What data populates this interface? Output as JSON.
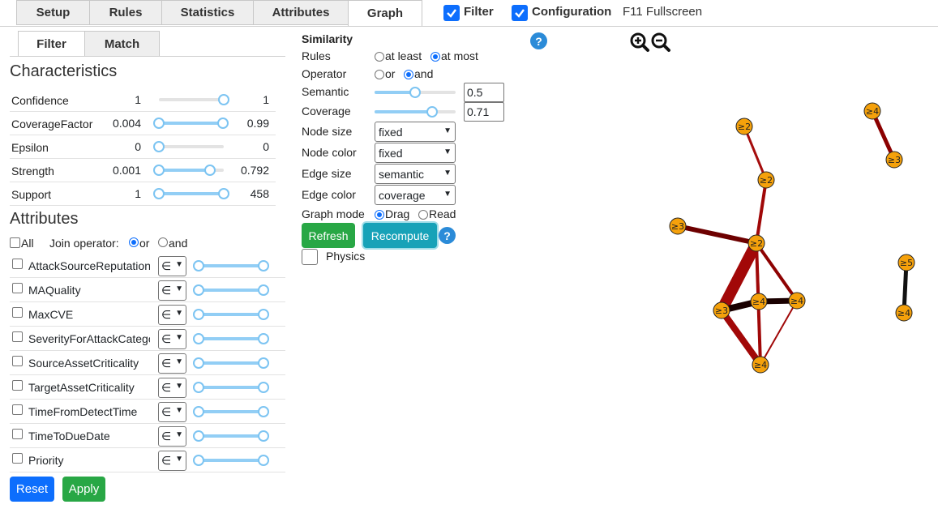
{
  "tabs": [
    "Setup",
    "Rules",
    "Statistics",
    "Attributes",
    "Graph"
  ],
  "active_tab": "Graph",
  "top_checks": {
    "filter": "Filter",
    "configuration": "Configuration"
  },
  "fullscreen": "F11 Fullscreen",
  "subtabs": [
    "Filter",
    "Match"
  ],
  "characteristics": {
    "title": "Characteristics",
    "rows": [
      {
        "label": "Confidence",
        "min": "1",
        "max": "1",
        "low": 1.0,
        "high": 1.0
      },
      {
        "label": "CoverageFactor",
        "min": "0.004",
        "max": "0.99",
        "low": 0.0,
        "high": 1.0
      },
      {
        "label": "Epsilon",
        "min": "0",
        "max": "0",
        "low": 0.0,
        "high": 0.0
      },
      {
        "label": "Strength",
        "min": "0.001",
        "max": "0.792",
        "low": 0.0,
        "high": 0.8
      },
      {
        "label": "Support",
        "min": "1",
        "max": "458",
        "low": 0.0,
        "high": 1.0
      }
    ]
  },
  "attributes": {
    "title": "Attributes",
    "all_label": "All",
    "join_label": "Join operator:",
    "or_label": "or",
    "and_label": "and",
    "operator_symbol": "∈",
    "items": [
      "AttackSourceReputation",
      "MAQuality",
      "MaxCVE",
      "SeverityForAttackCategory",
      "SourceAssetCriticality",
      "TargetAssetCriticality",
      "TimeFromDetectTime",
      "TimeToDueDate",
      "Priority"
    ]
  },
  "buttons": {
    "reset": "Reset",
    "apply": "Apply",
    "refresh": "Refresh",
    "recompute": "Recompute"
  },
  "similarity": {
    "title": "Similarity",
    "rules_label": "Rules",
    "rules_options": [
      "at least",
      "at most"
    ],
    "operator_label": "Operator",
    "operator_options": [
      "or",
      "and"
    ],
    "semantic_label": "Semantic",
    "semantic_value": "0.5",
    "semantic_level": 0.5,
    "coverage_label": "Coverage",
    "coverage_value": "0.71",
    "coverage_level": 0.71
  },
  "settings": {
    "node_size": {
      "label": "Node size",
      "value": "fixed"
    },
    "node_color": {
      "label": "Node color",
      "value": "fixed"
    },
    "edge_size": {
      "label": "Edge size",
      "value": "semantic"
    },
    "edge_color": {
      "label": "Edge color",
      "value": "coverage"
    },
    "graph_mode_label": "Graph mode",
    "graph_mode_options": [
      "Drag",
      "Read"
    ],
    "physics_label": "Physics"
  },
  "help_symbol": "?",
  "graph": {
    "node_color": "#f5a10b",
    "nodes": [
      "≥4",
      "≥3",
      "≥2",
      "≥2",
      "≥3",
      "≥2",
      "≥5",
      "≥4",
      "≥3",
      "≥4",
      "≥4",
      "≥4"
    ]
  }
}
